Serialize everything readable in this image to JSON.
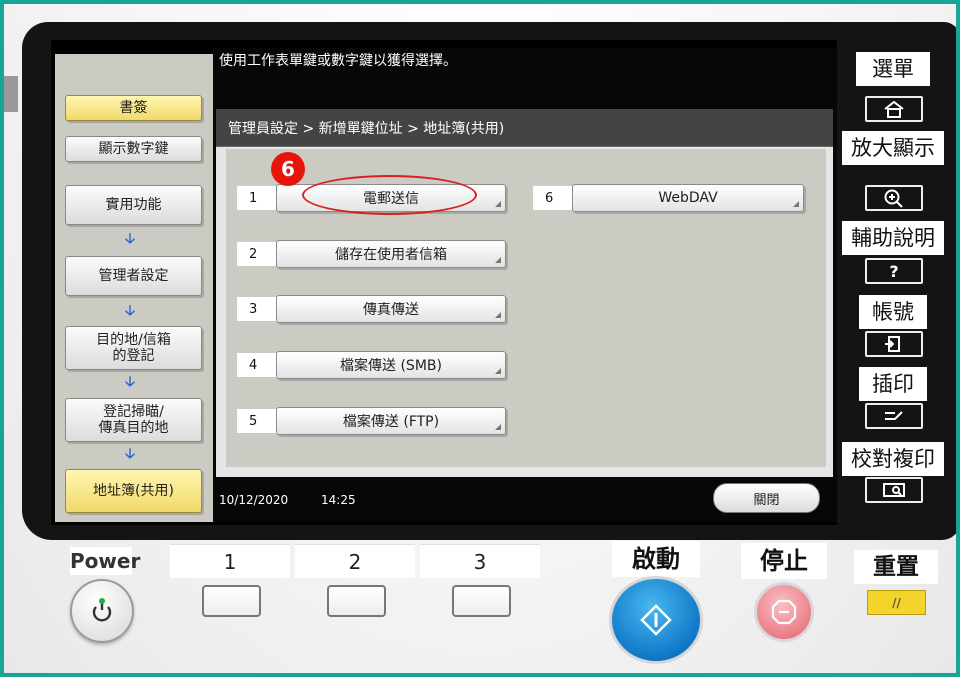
{
  "instruction": "使用工作表單鍵或數字鍵以獲得選擇。",
  "breadcrumb": "管理員設定 > 新增單鍵位址 > 地址簿(共用)",
  "sidebar": {
    "bookmark": "書簽",
    "show_numbers": "顯示數字鍵",
    "utility": "實用功能",
    "admin_settings": "管理者設定",
    "dest_registration": "目的地/信箱\n的登記",
    "scan_fax_dest": "登記掃瞄/\n傳真目的地",
    "address_book": "地址簿(共用)"
  },
  "destinations": [
    {
      "num": "1",
      "label": "電郵送信"
    },
    {
      "num": "2",
      "label": "儲存在使用者信箱"
    },
    {
      "num": "3",
      "label": "傳真傳送"
    },
    {
      "num": "4",
      "label": "檔案傳送 (SMB)"
    },
    {
      "num": "5",
      "label": "檔案傳送 (FTP)"
    },
    {
      "num": "6",
      "label": "WebDAV"
    }
  ],
  "step_marker": "6",
  "status": {
    "date": "10/12/2020",
    "time": "14:25"
  },
  "close_label": "關閉",
  "hard_keys": {
    "menu": "選單",
    "zoom": "放大顯示",
    "guide": "輔助說明",
    "account": "帳號",
    "interrupt": "插印",
    "proof_copy": "校對複印"
  },
  "bottom": {
    "power": "Power",
    "registers": [
      "1",
      "2",
      "3"
    ],
    "start": "啟動",
    "stop": "停止",
    "reset": "重置"
  },
  "colors": {
    "frame": "#19a596",
    "highlight_yellow": "#f0d86a",
    "annotation_red": "#d81e1e",
    "start_blue": "#0f78c8",
    "stop_pink": "#ea7e88"
  }
}
